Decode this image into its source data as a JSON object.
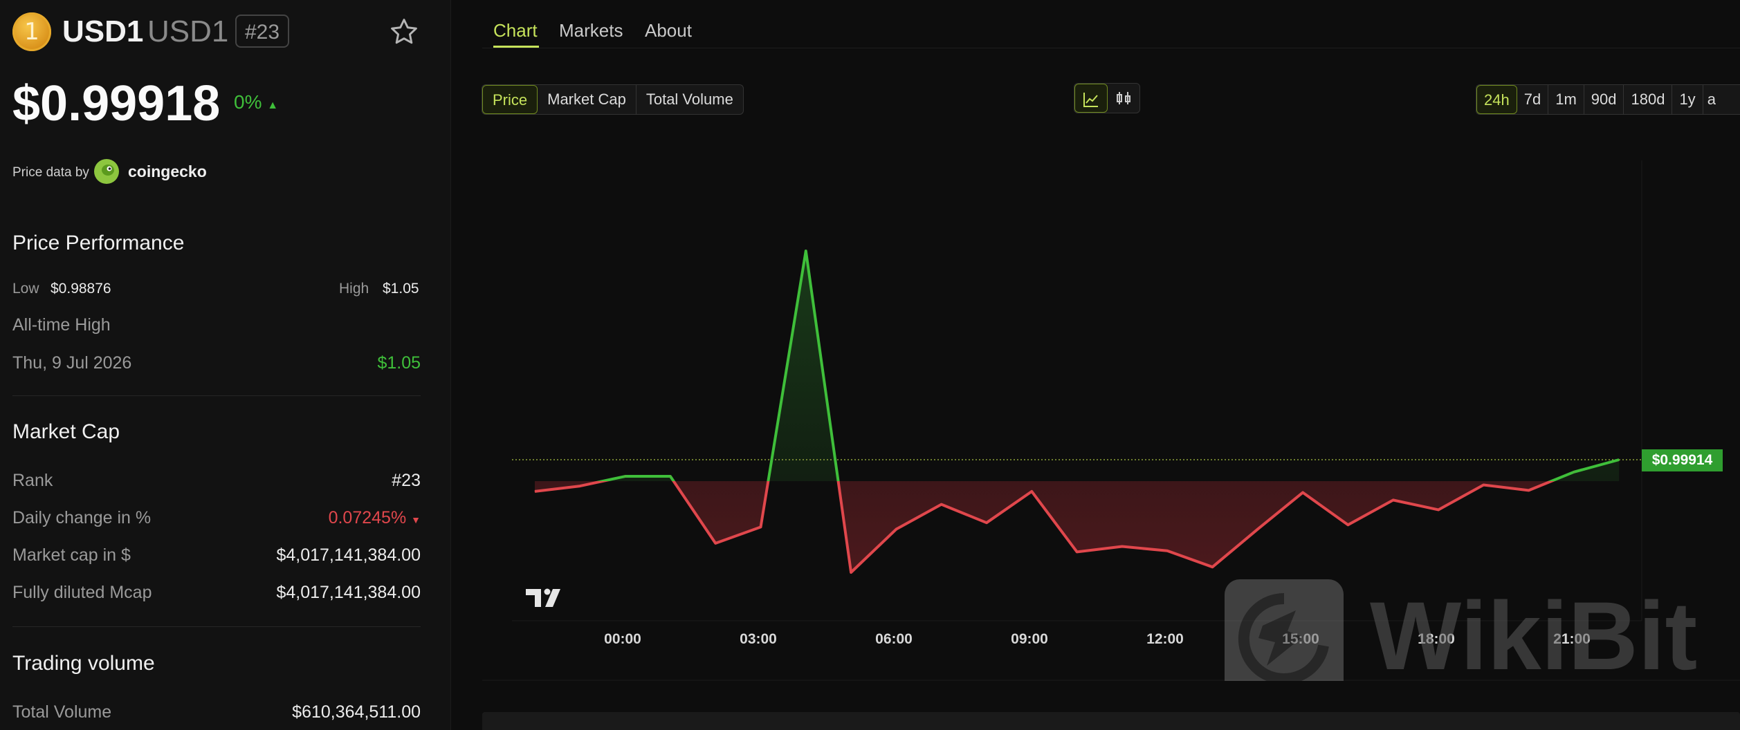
{
  "coin": {
    "icon_glyph": "1",
    "symbol": "USD1",
    "name": "USD1",
    "rank_badge": "#23",
    "price": "$0.99918",
    "change": "0%",
    "change_arrow": "▲"
  },
  "attribution": {
    "prefix": "Price data by",
    "provider": "coingecko"
  },
  "performance": {
    "title": "Price Performance",
    "low_label": "Low",
    "low_value": "$0.98876",
    "high_label": "High",
    "high_value": "$1.05",
    "ath_label": "All-time High",
    "ath_date": "Thu, 9 Jul 2026",
    "ath_value": "$1.05"
  },
  "market_cap": {
    "title": "Market Cap",
    "rank_label": "Rank",
    "rank_value": "#23",
    "daily_label": "Daily change in %",
    "daily_value": "0.07245%",
    "daily_arrow": "▼",
    "mcap_label": "Market cap in $",
    "mcap_value": "$4,017,141,384.00",
    "fdv_label": "Fully diluted Mcap",
    "fdv_value": "$4,017,141,384.00"
  },
  "volume": {
    "title": "Trading volume",
    "total_label": "Total Volume",
    "total_value": "$610,364,511.00"
  },
  "nav": {
    "tabs": [
      "Chart",
      "Markets",
      "About"
    ],
    "active": "Chart"
  },
  "metric_toggle": [
    "Price",
    "Market Cap",
    "Total Volume"
  ],
  "ranges": [
    "24h",
    "7d",
    "1m",
    "90d",
    "180d",
    "1y",
    "a"
  ],
  "chart_icons": [
    "line-chart-icon",
    "candlestick-icon"
  ],
  "colors": {
    "accent": "#c6e35b",
    "up": "#3fbf3a",
    "down": "#e0474c"
  },
  "chart_data": {
    "type": "line",
    "x_ticks": [
      "00:00",
      "03:00",
      "06:00",
      "09:00",
      "12:00",
      "15:00",
      "18:00",
      "21:00"
    ],
    "reference_price": 0.99914,
    "last_price_label": "$0.99914",
    "series": [
      {
        "values": [
          0.9962,
          0.9967,
          0.9976,
          0.9976,
          0.9914,
          0.9929,
          1.049,
          0.9887,
          0.9927,
          0.995,
          0.9933,
          0.9962,
          0.9906,
          0.9911,
          0.9907,
          0.9892,
          0.9927,
          0.9961,
          0.9931,
          0.9954,
          0.9945,
          0.9968,
          0.9963,
          0.998,
          0.99914
        ]
      }
    ],
    "watermark": "WikiBit"
  }
}
